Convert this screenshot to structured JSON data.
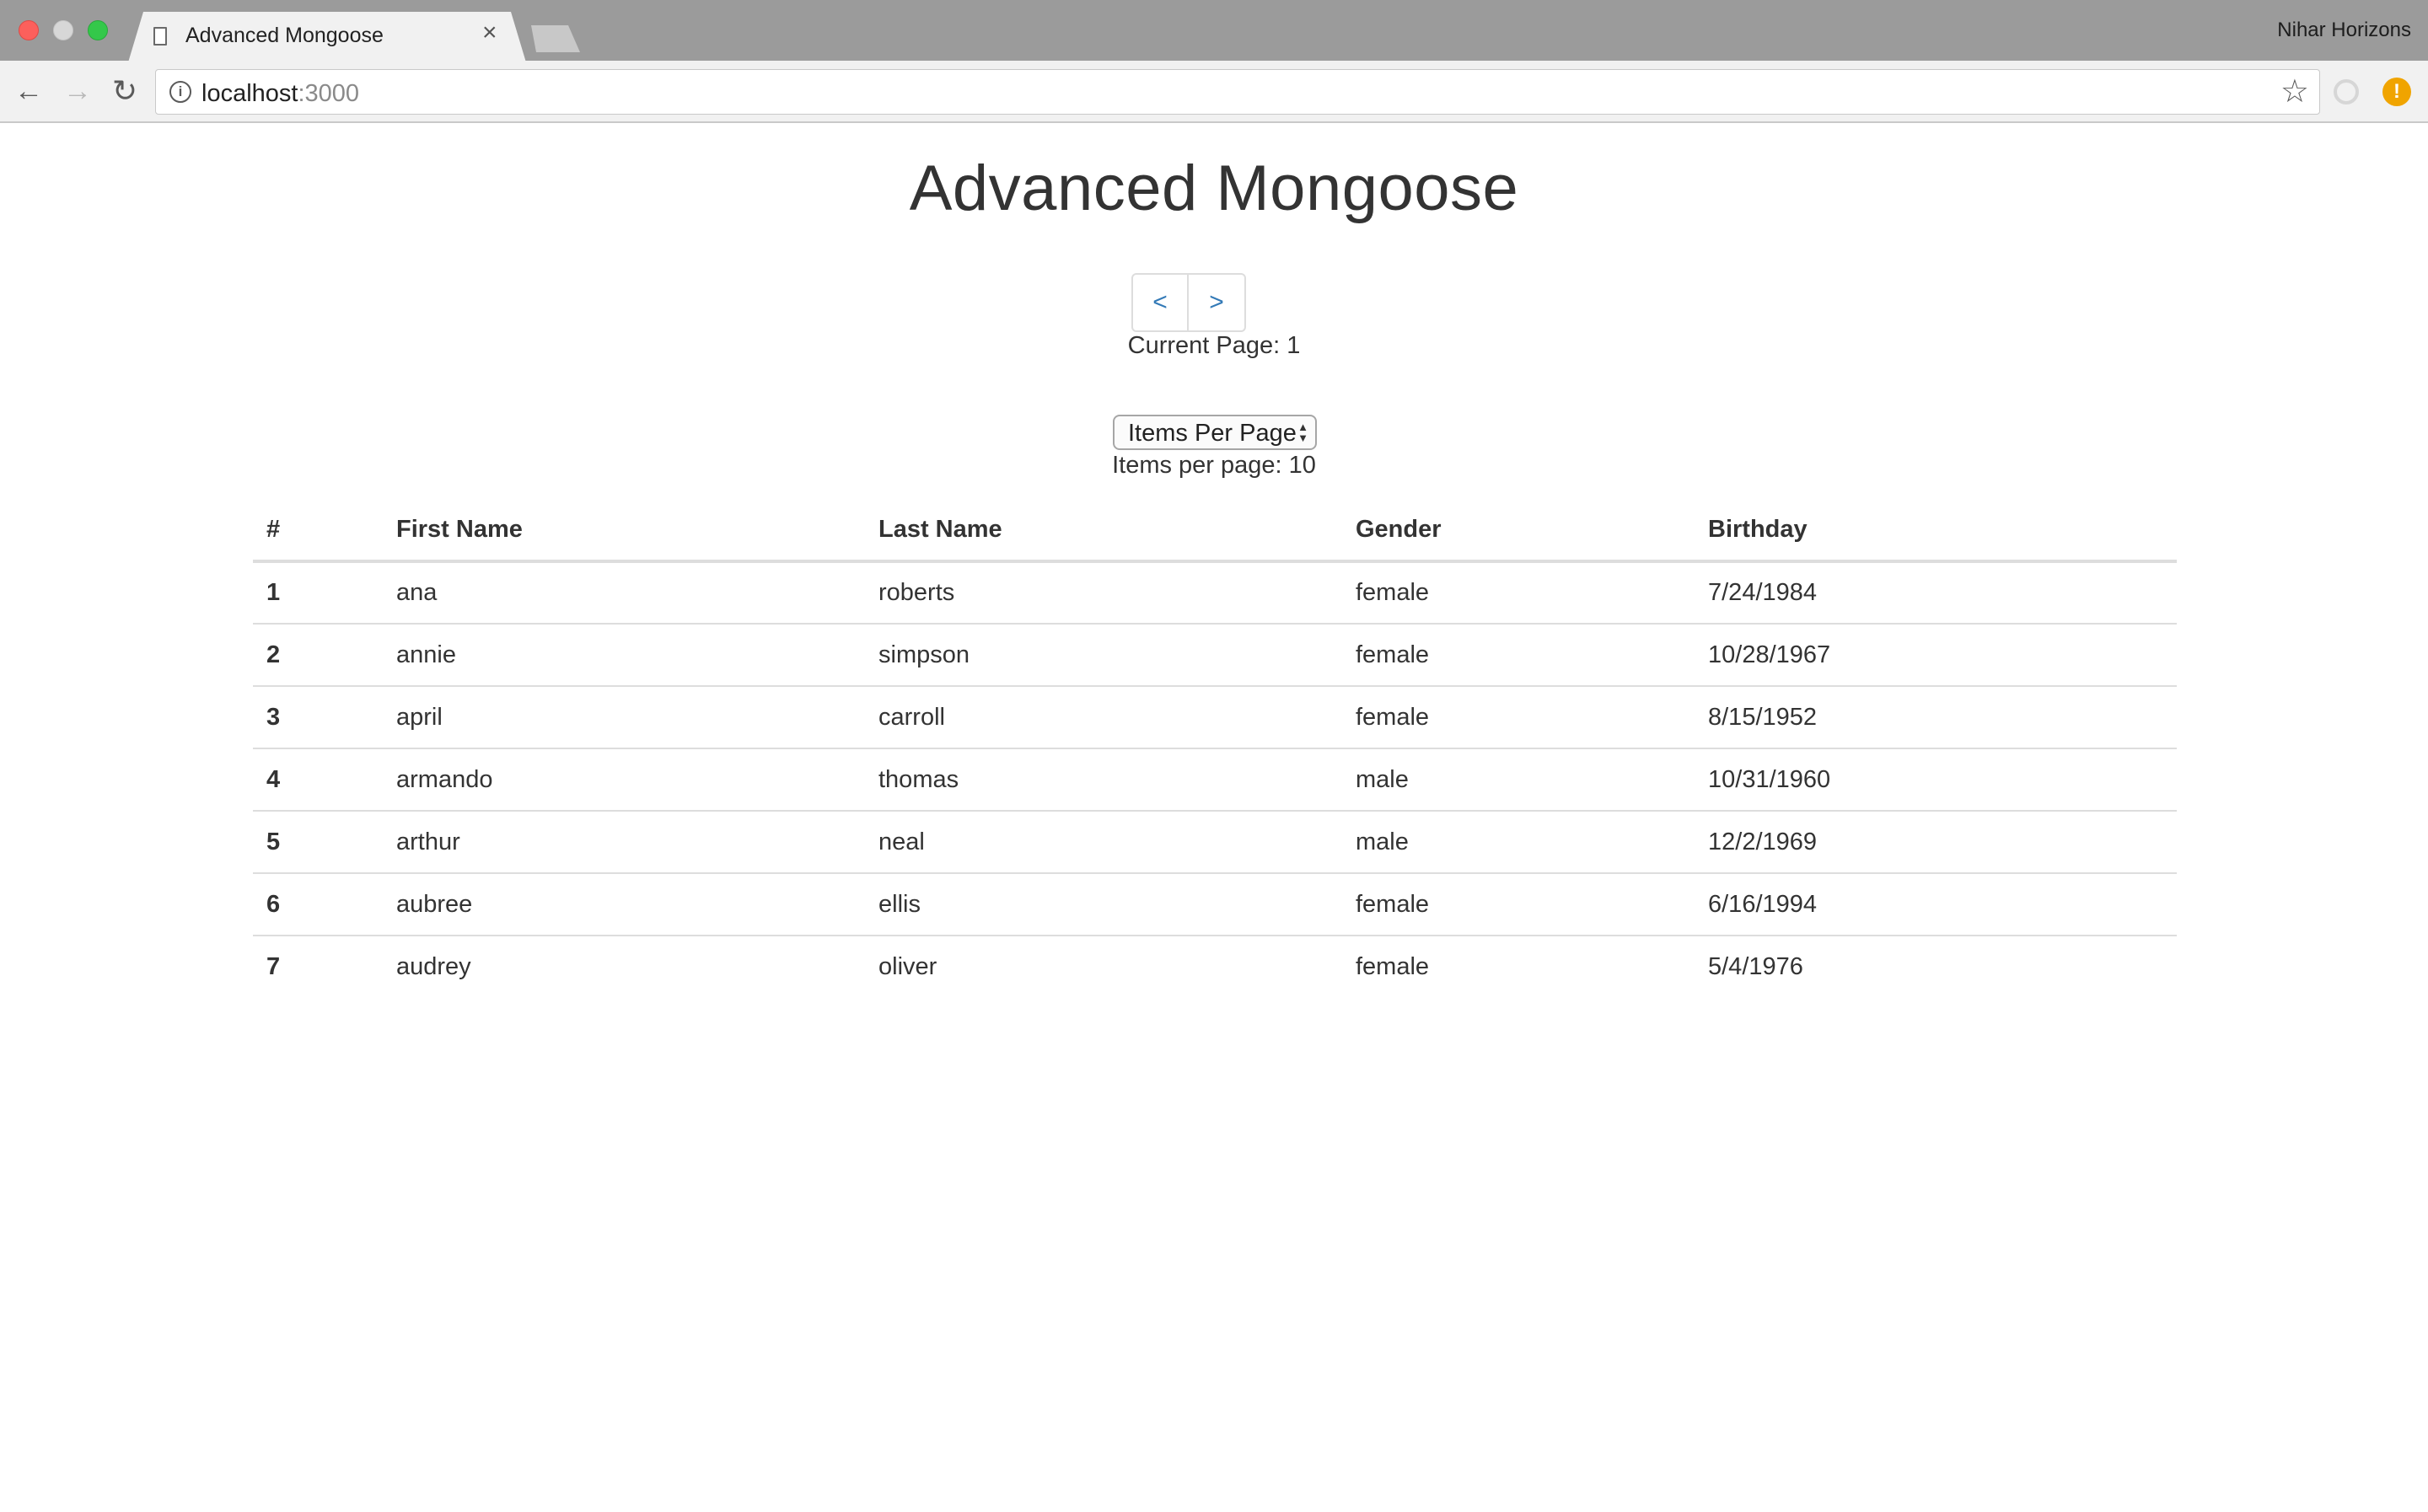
{
  "browser": {
    "tab_title": "Advanced Mongoose",
    "tab_close": "×",
    "profile_name": "Nihar Horizons",
    "url_host": "localhost",
    "url_port": ":3000",
    "icons": {
      "back": "←",
      "forward": "→",
      "reload": "↻",
      "info": "i",
      "star": "☆",
      "alert": "!"
    }
  },
  "page": {
    "title": "Advanced Mongoose",
    "pager": {
      "prev_label": "<",
      "next_label": ">",
      "current_page_text": "Current Page: 1"
    },
    "items_select": {
      "label": "Items Per Page",
      "arrows": "▲▼"
    },
    "items_per_page_text": "Items per page: 10",
    "table": {
      "headers": [
        "#",
        "First Name",
        "Last Name",
        "Gender",
        "Birthday"
      ],
      "rows": [
        {
          "num": "1",
          "first": "ana",
          "last": "roberts",
          "gender": "female",
          "birthday": "7/24/1984"
        },
        {
          "num": "2",
          "first": "annie",
          "last": "simpson",
          "gender": "female",
          "birthday": "10/28/1967"
        },
        {
          "num": "3",
          "first": "april",
          "last": "carroll",
          "gender": "female",
          "birthday": "8/15/1952"
        },
        {
          "num": "4",
          "first": "armando",
          "last": "thomas",
          "gender": "male",
          "birthday": "10/31/1960"
        },
        {
          "num": "5",
          "first": "arthur",
          "last": "neal",
          "gender": "male",
          "birthday": "12/2/1969"
        },
        {
          "num": "6",
          "first": "aubree",
          "last": "ellis",
          "gender": "female",
          "birthday": "6/16/1994"
        },
        {
          "num": "7",
          "first": "audrey",
          "last": "oliver",
          "gender": "female",
          "birthday": "5/4/1976"
        }
      ]
    }
  },
  "colors": {
    "link_blue": "#337ab7",
    "text": "#333333",
    "border": "#dddddd"
  }
}
